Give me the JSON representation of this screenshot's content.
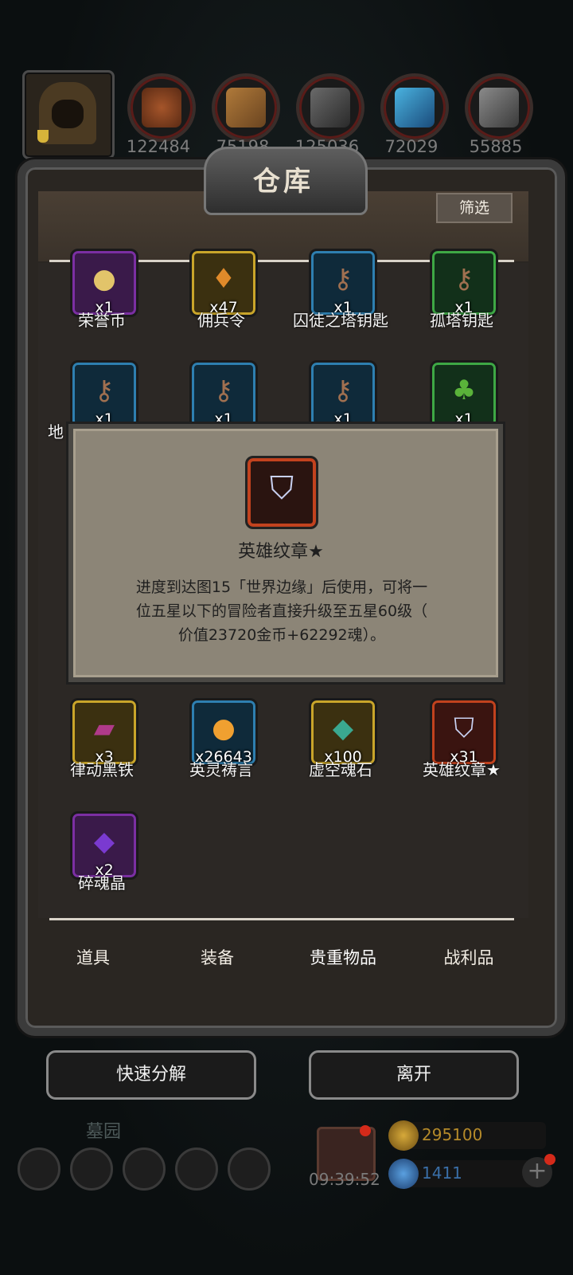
{
  "resources": [
    {
      "icon": "avatar",
      "value": ""
    },
    {
      "icon": "meat-icon",
      "value": "122484"
    },
    {
      "icon": "wood-icon",
      "value": "75198"
    },
    {
      "icon": "iron-icon",
      "value": "125036"
    },
    {
      "icon": "crystal-icon",
      "value": "72029"
    },
    {
      "icon": "steel-icon",
      "value": "55885"
    }
  ],
  "panel": {
    "title": "仓库",
    "filter_label": "筛选"
  },
  "items": [
    {
      "name": "荣誉币",
      "count": "x1",
      "rarity": "purple",
      "icon": "coin-icon"
    },
    {
      "name": "佣兵令",
      "count": "x47",
      "rarity": "gold",
      "icon": "badge-icon"
    },
    {
      "name": "囚徒之塔钥匙",
      "count": "x1",
      "rarity": "blue",
      "icon": "key-icon"
    },
    {
      "name": "孤塔钥匙",
      "count": "x1",
      "rarity": "green",
      "icon": "key-icon"
    },
    {
      "name": "地",
      "count": "x1",
      "rarity": "blue",
      "icon": "key-icon"
    },
    {
      "name": "",
      "count": "x1",
      "rarity": "blue",
      "icon": "key-icon"
    },
    {
      "name": "",
      "count": "x1",
      "rarity": "blue",
      "icon": "key-icon"
    },
    {
      "name": "",
      "count": "x1",
      "rarity": "green",
      "icon": "tree-icon"
    },
    {
      "name": "律动黑铁",
      "count": "x3",
      "rarity": "gold",
      "icon": "ingot-icon"
    },
    {
      "name": "英灵祷言",
      "count": "x26643",
      "rarity": "blue",
      "icon": "orb-icon"
    },
    {
      "name": "虚空魂石",
      "count": "x100",
      "rarity": "gold",
      "icon": "stone-icon"
    },
    {
      "name": "英雄纹章★",
      "count": "x31",
      "rarity": "red",
      "icon": "crest-icon"
    },
    {
      "name": "碎魂晶",
      "count": "x2",
      "rarity": "purple",
      "icon": "shard-icon"
    }
  ],
  "tooltip": {
    "item_name": "英雄纹章★",
    "description_line1": "进度到达图15「世界边缘」后使用，可将一",
    "description_line2": "位五星以下的冒险者直接升级至五星60级（",
    "description_line3": "价值23720金币+62292魂）。"
  },
  "tabs": [
    {
      "label": "道具"
    },
    {
      "label": "装备"
    },
    {
      "label": "贵重物品"
    },
    {
      "label": "战利品"
    }
  ],
  "buttons": {
    "decompose": "快速分解",
    "leave": "离开"
  },
  "hud": {
    "location": "墓园",
    "timer": "09:39:52",
    "gold": "295100",
    "gems": "1411"
  },
  "colors": {
    "gold_text": "#b58a2a",
    "gem_text": "#3a6fa8",
    "rarity_red": "#c2421e"
  }
}
